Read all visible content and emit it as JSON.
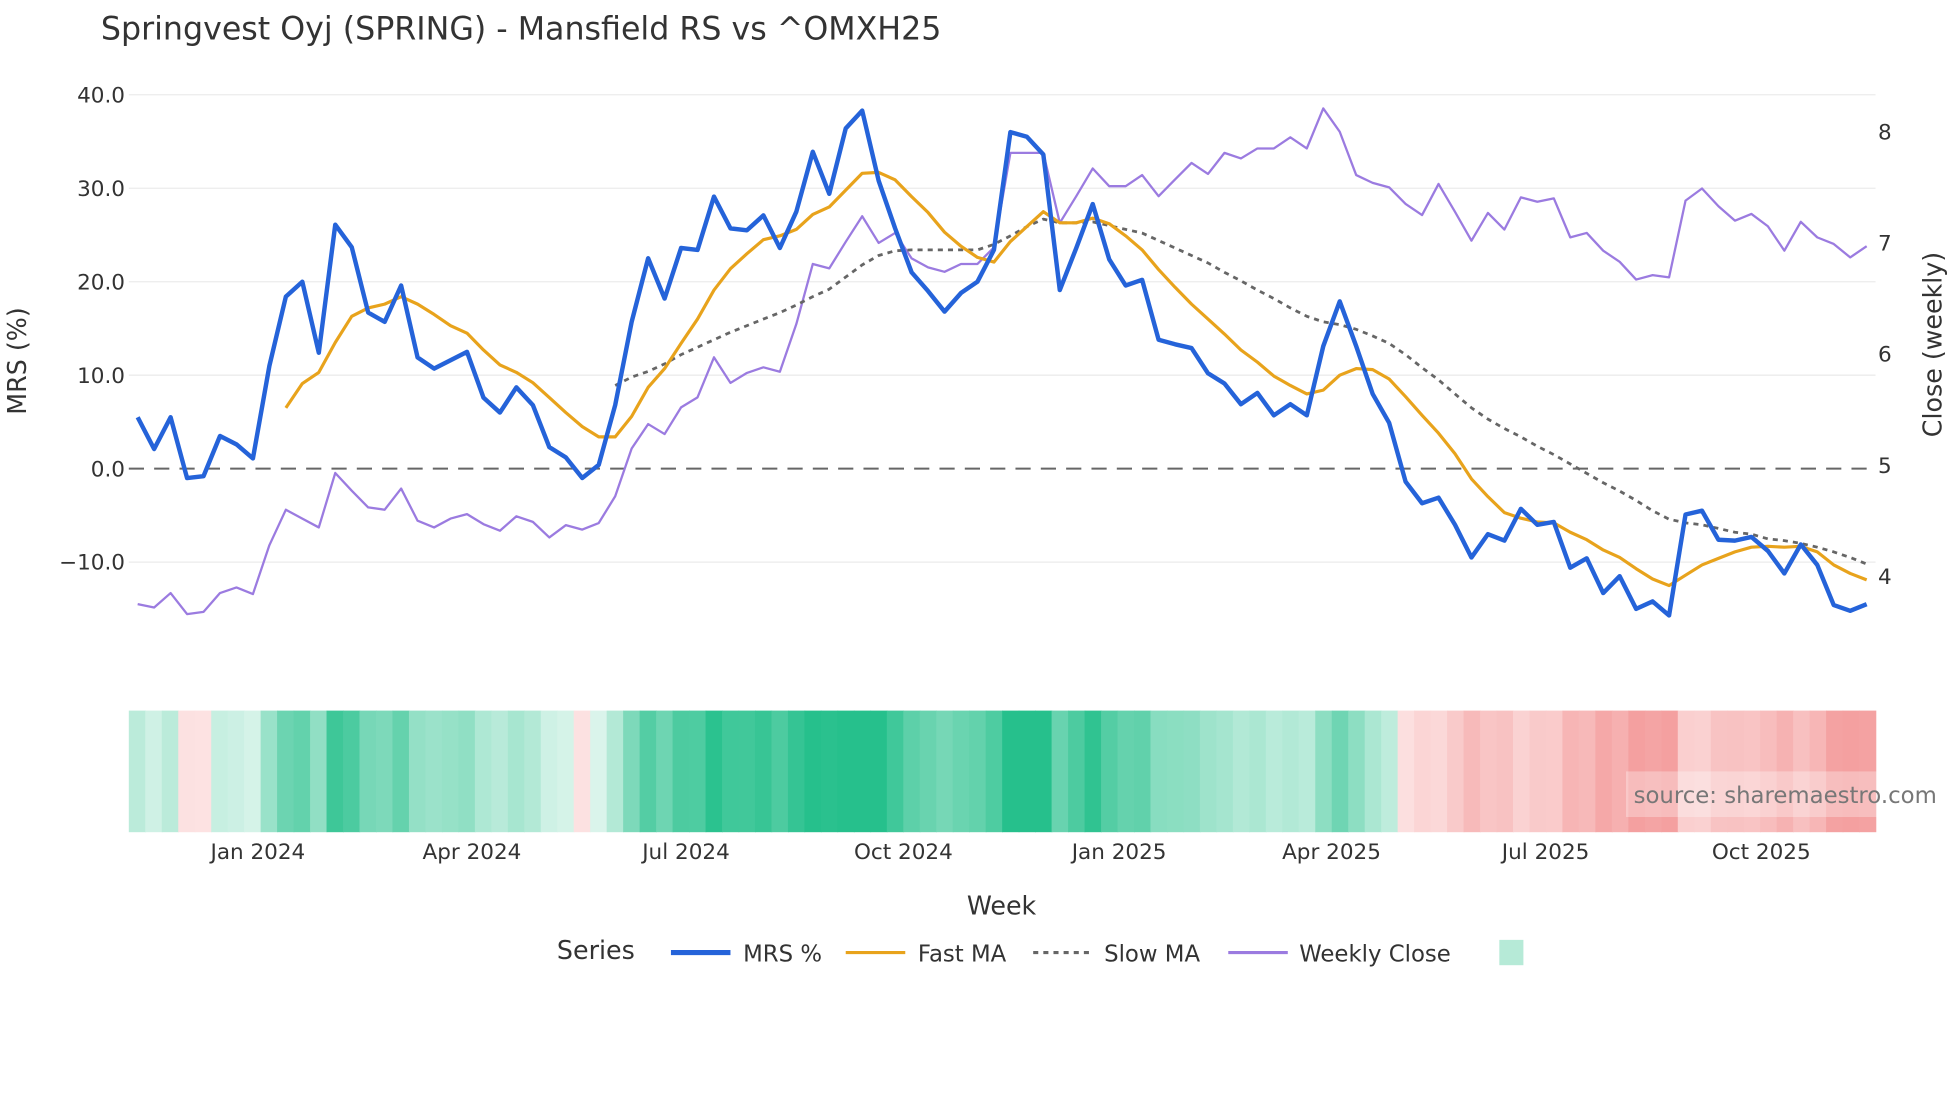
{
  "chart_data": {
    "type": "line",
    "title": "Springvest Oyj (SPRING) - Mansfield RS vs ^OMXH25",
    "xlabel": "Week",
    "ylabel": "MRS (%)",
    "y2label": "Close (weekly)",
    "ylim": [
      -17,
      41
    ],
    "y2lim": [
      3.5,
      8.4
    ],
    "yticks": [
      40,
      30,
      20,
      10,
      0,
      -10
    ],
    "ytick_labels": [
      "40.0",
      "30.0",
      "20.0",
      "10.0",
      "0.0",
      "−10.0"
    ],
    "y2ticks": [
      8,
      7,
      6,
      5,
      4
    ],
    "y2tick_labels": [
      "8",
      "7",
      "6",
      "5",
      "4"
    ],
    "xticks": [
      {
        "label": "Jan 2024",
        "week_index": 7.3
      },
      {
        "label": "Apr 2024",
        "week_index": 20.3
      },
      {
        "label": "Jul 2024",
        "week_index": 33.3
      },
      {
        "label": "Oct 2024",
        "week_index": 46.5
      },
      {
        "label": "Jan 2025",
        "week_index": 59.6
      },
      {
        "label": "Apr 2025",
        "week_index": 72.5
      },
      {
        "label": "Jul 2025",
        "week_index": 85.5
      },
      {
        "label": "Oct 2025",
        "week_index": 98.6
      }
    ],
    "n_weeks": 106,
    "zero_line": 0,
    "grid": true,
    "legend": {
      "title": "Series",
      "placement": "bottom-center"
    },
    "series": [
      {
        "name": "MRS %",
        "axis": "left",
        "color": "#2563d9",
        "style": "solid-thick",
        "start": 0,
        "values": [
          5.5,
          2.1,
          5.5,
          -1,
          -0.8,
          3.5,
          2.6,
          1.1,
          11,
          18.4,
          20,
          12.4,
          26.1,
          23.7,
          16.7,
          15.7,
          19.6,
          11.9,
          10.7,
          11.6,
          12.5,
          7.6,
          6,
          8.7,
          6.8,
          2.3,
          1.2,
          -1,
          0.4,
          6.8,
          15.7,
          22.5,
          18.2,
          23.6,
          23.4,
          29.1,
          25.7,
          25.5,
          27.1,
          23.6,
          27.5,
          33.9,
          29.4,
          36.4,
          38.3,
          30.8,
          25.7,
          21,
          19,
          16.8,
          18.8,
          20,
          23.4,
          36,
          35.5,
          33.6,
          19.1,
          23.6,
          28.3,
          22.4,
          19.6,
          20.2,
          13.8,
          13.3,
          12.9,
          10.2,
          9.1,
          6.9,
          8.1,
          5.7,
          6.9,
          5.7,
          13.1,
          17.9,
          13.1,
          8,
          4.9,
          -1.4,
          -3.7,
          -3.1,
          -6,
          -9.5,
          -7,
          -7.7,
          -4.3,
          -6,
          -5.7,
          -10.6,
          -9.6,
          -13.3,
          -11.5,
          -15,
          -14.2,
          -15.7,
          -4.9,
          -4.5,
          -7.6,
          -7.7,
          -7.3,
          -8.8,
          -11.2,
          -8.1,
          -10.3,
          -14.6,
          -15.2,
          -14.5
        ]
      },
      {
        "name": "Fast MA",
        "axis": "left",
        "color": "#e8a31c",
        "style": "solid",
        "start": 9,
        "values": [
          6.5,
          9.1,
          10.3,
          13.5,
          16.3,
          17.2,
          17.6,
          18.4,
          17.6,
          16.5,
          15.3,
          14.5,
          12.7,
          11.1,
          10.3,
          9.2,
          7.6,
          6,
          4.5,
          3.4,
          3.4,
          5.6,
          8.7,
          10.7,
          13.4,
          16,
          19.1,
          21.4,
          23,
          24.5,
          24.9,
          25.6,
          27.2,
          28,
          29.8,
          31.6,
          31.7,
          30.9,
          29.1,
          27.4,
          25.3,
          23.8,
          22.6,
          22.1,
          24.3,
          25.9,
          27.5,
          26.3,
          26.3,
          26.8,
          26.2,
          24.9,
          23.4,
          21.3,
          19.4,
          17.6,
          16,
          14.4,
          12.7,
          11.4,
          9.9,
          8.9,
          8,
          8.4,
          10,
          10.7,
          10.6,
          9.6,
          7.7,
          5.7,
          3.8,
          1.6,
          -1.1,
          -3,
          -4.7,
          -5.3,
          -5.7,
          -5.8,
          -6.8,
          -7.6,
          -8.7,
          -9.5,
          -10.7,
          -11.8,
          -12.5,
          -11.4,
          -10.3,
          -9.6,
          -8.9,
          -8.4,
          -8.3,
          -8.4,
          -8.3,
          -8.9,
          -10.3,
          -11.2,
          -11.9
        ]
      },
      {
        "name": "Slow MA",
        "axis": "left",
        "color": "#666666",
        "style": "dotted",
        "start": 29,
        "values": [
          8.9,
          9.8,
          10.4,
          11.2,
          12.2,
          13,
          13.8,
          14.6,
          15.3,
          16,
          16.7,
          17.5,
          18.4,
          19.2,
          20.5,
          21.8,
          22.8,
          23.3,
          23.4,
          23.4,
          23.4,
          23.4,
          23.4,
          24,
          24.9,
          25.9,
          26.7,
          26.3,
          26.3,
          26.4,
          26,
          25.6,
          25.2,
          24.4,
          23.6,
          22.8,
          22,
          21,
          20.1,
          19.1,
          18.2,
          17.2,
          16.3,
          15.7,
          15.4,
          14.9,
          14.2,
          13.4,
          12.2,
          10.8,
          9.5,
          8,
          6.5,
          5.3,
          4.3,
          3.4,
          2.4,
          1.5,
          0.5,
          -0.5,
          -1.5,
          -2.4,
          -3.4,
          -4.5,
          -5.4,
          -5.8,
          -6,
          -6.4,
          -6.8,
          -7,
          -7.5,
          -7.7,
          -8,
          -8.4,
          -8.9,
          -9.5,
          -10.2
        ]
      },
      {
        "name": "Weekly Close",
        "axis": "right",
        "color": "#9b7be0",
        "style": "solid-thin",
        "start": 0,
        "values": [
          3.75,
          3.72,
          3.85,
          3.66,
          3.68,
          3.85,
          3.9,
          3.84,
          4.28,
          4.6,
          4.52,
          4.44,
          4.93,
          4.77,
          4.62,
          4.6,
          4.79,
          4.5,
          4.44,
          4.52,
          4.56,
          4.47,
          4.41,
          4.54,
          4.49,
          4.35,
          4.46,
          4.42,
          4.48,
          4.72,
          5.15,
          5.37,
          5.28,
          5.52,
          5.61,
          5.97,
          5.74,
          5.83,
          5.88,
          5.84,
          6.27,
          6.81,
          6.77,
          7.01,
          7.24,
          7,
          7.09,
          6.86,
          6.78,
          6.74,
          6.81,
          6.81,
          6.96,
          7.81,
          7.81,
          7.81,
          7.18,
          7.42,
          7.67,
          7.51,
          7.51,
          7.61,
          7.42,
          7.57,
          7.72,
          7.62,
          7.81,
          7.76,
          7.85,
          7.85,
          7.95,
          7.85,
          8.21,
          8,
          7.61,
          7.54,
          7.5,
          7.35,
          7.25,
          7.53,
          7.28,
          7.02,
          7.27,
          7.12,
          7.41,
          7.37,
          7.4,
          7.05,
          7.09,
          6.93,
          6.83,
          6.67,
          6.71,
          6.69,
          7.38,
          7.49,
          7.33,
          7.2,
          7.26,
          7.15,
          6.93,
          7.19,
          7.05,
          6.99,
          6.87,
          6.97
        ]
      }
    ],
    "heatmap": {
      "source_series": "MRS %",
      "positive_color": "#26c08c",
      "negative_color": "#f4a0a0"
    }
  },
  "source_note": "source: sharemaestro.com"
}
